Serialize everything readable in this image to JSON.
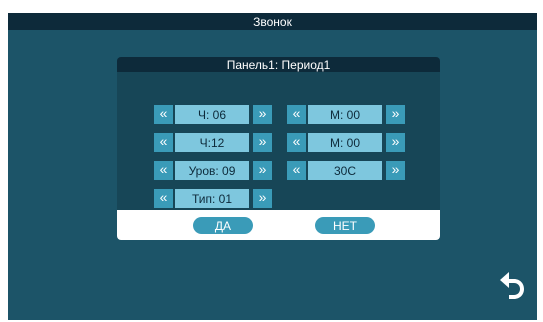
{
  "window": {
    "title": "Звонок"
  },
  "dialog": {
    "title": "Панель1: Период1"
  },
  "rows": [
    {
      "left_value": "Ч: 06",
      "right_value": "М: 00"
    },
    {
      "left_value": "Ч:12",
      "right_value": "М: 00"
    },
    {
      "left_value": "Уров: 09",
      "right_value": "30С"
    },
    {
      "left_value": "Тип: 01"
    }
  ],
  "arrows": {
    "left": "«",
    "right": "»"
  },
  "buttons": {
    "yes": "ДА",
    "no": "НЕТ"
  },
  "icons": {
    "back": "return-arrow-icon"
  },
  "colors": {
    "background": "#1c5468",
    "bar": "#0d2a3a",
    "button": "#3a9bb8",
    "field": "#7ec7de"
  }
}
